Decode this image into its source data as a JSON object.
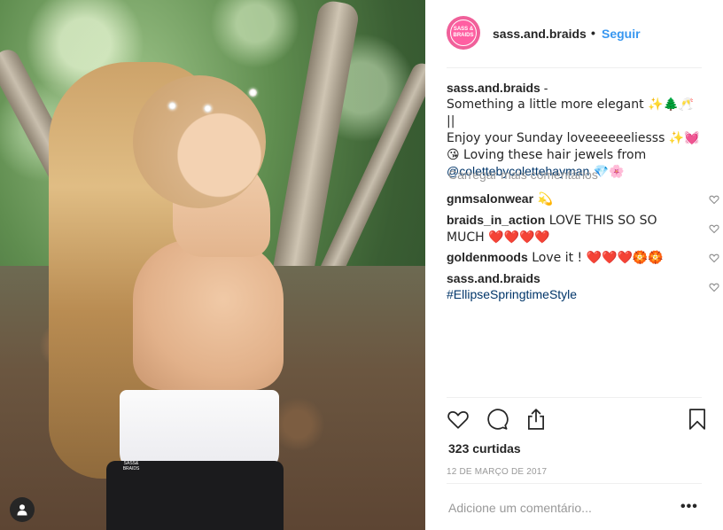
{
  "post": {
    "username": "sass.and.braids",
    "separator": "•",
    "follow_label": "Seguir",
    "avatar_text_top": "SASS &",
    "avatar_text_bottom": "BRAIDS",
    "caption": {
      "author": "sass.and.braids",
      "dash": " -",
      "line1": "Something a little more elegant ✨🌲🥂 ||",
      "line2": "Enjoy your Sunday loveeeeeeliesss ✨💓",
      "line3": "😘 Loving these hair jewels from",
      "mention": "@colettebycolettehayman",
      "mention_suffix": " 💎🌸"
    },
    "load_more": "Carregar mais comentários",
    "comments": [
      {
        "author": "gnmsalonwear",
        "text": " 💫"
      },
      {
        "author": "braids_in_action",
        "text": " LOVE THIS SO SO MUCH ❤️❤️❤️❤️"
      },
      {
        "author": "goldenmoods",
        "text": " Love it ! ❤️❤️❤️🏵️🏵️"
      },
      {
        "author": "sass.and.braids",
        "hashtag": "#EllipseSpringtimeStyle"
      }
    ],
    "likes": "323 curtidas",
    "date": "12 DE MARÇO DE 2017",
    "add_comment_placeholder": "Adicione um comentário...",
    "more_options": "•••",
    "watermark_top": "SASS&",
    "watermark_bottom": "BRAIDS"
  },
  "icons": {
    "like": "heart-icon",
    "comment": "comment-icon",
    "share": "share-icon",
    "save": "bookmark-icon",
    "profile": "user-icon"
  },
  "colors": {
    "accent": "#3897f0",
    "text": "#262626",
    "muted": "#999999",
    "link": "#003569",
    "avatar": "#f0609a"
  }
}
